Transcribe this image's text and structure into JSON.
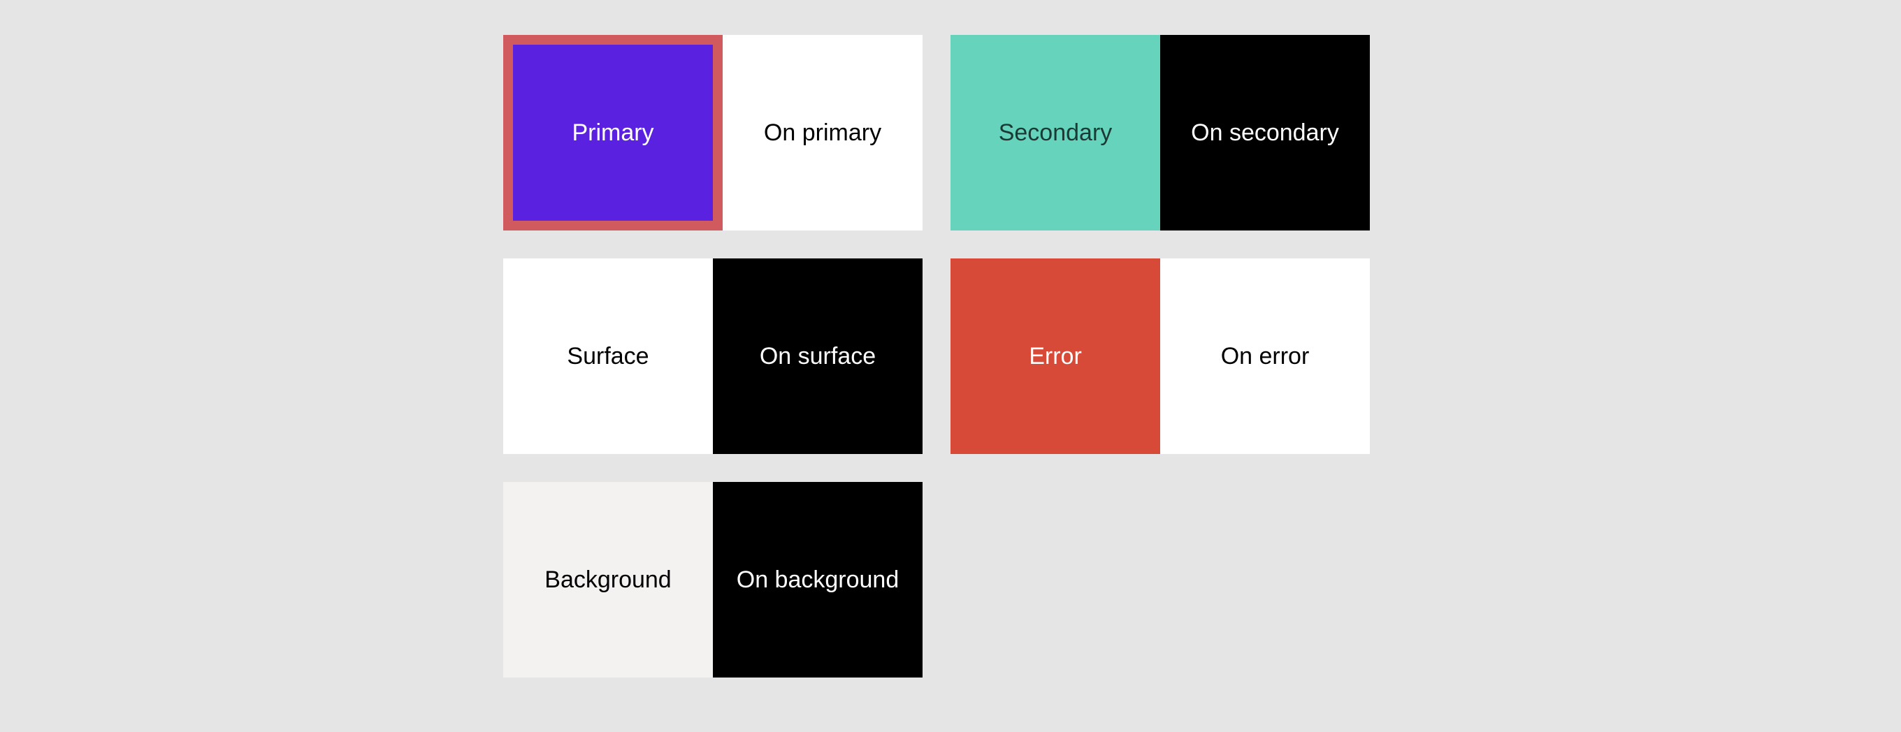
{
  "palette": {
    "primary": {
      "label": "Primary",
      "on_label": "On primary",
      "color": "#5a22e0",
      "on_color": "#ffffff",
      "selected": true
    },
    "secondary": {
      "label": "Secondary",
      "on_label": "On secondary",
      "color": "#66d4bc",
      "on_color": "#000000",
      "selected": false
    },
    "surface": {
      "label": "Surface",
      "on_label": "On surface",
      "color": "#ffffff",
      "on_color": "#000000",
      "selected": false
    },
    "error": {
      "label": "Error",
      "on_label": "On error",
      "color": "#d84a38",
      "on_color": "#ffffff",
      "selected": false
    },
    "background": {
      "label": "Background",
      "on_label": "On background",
      "color": "#f4f1f1",
      "on_color": "#000000",
      "selected": false
    }
  },
  "selection_border_color": "#d05a5d"
}
